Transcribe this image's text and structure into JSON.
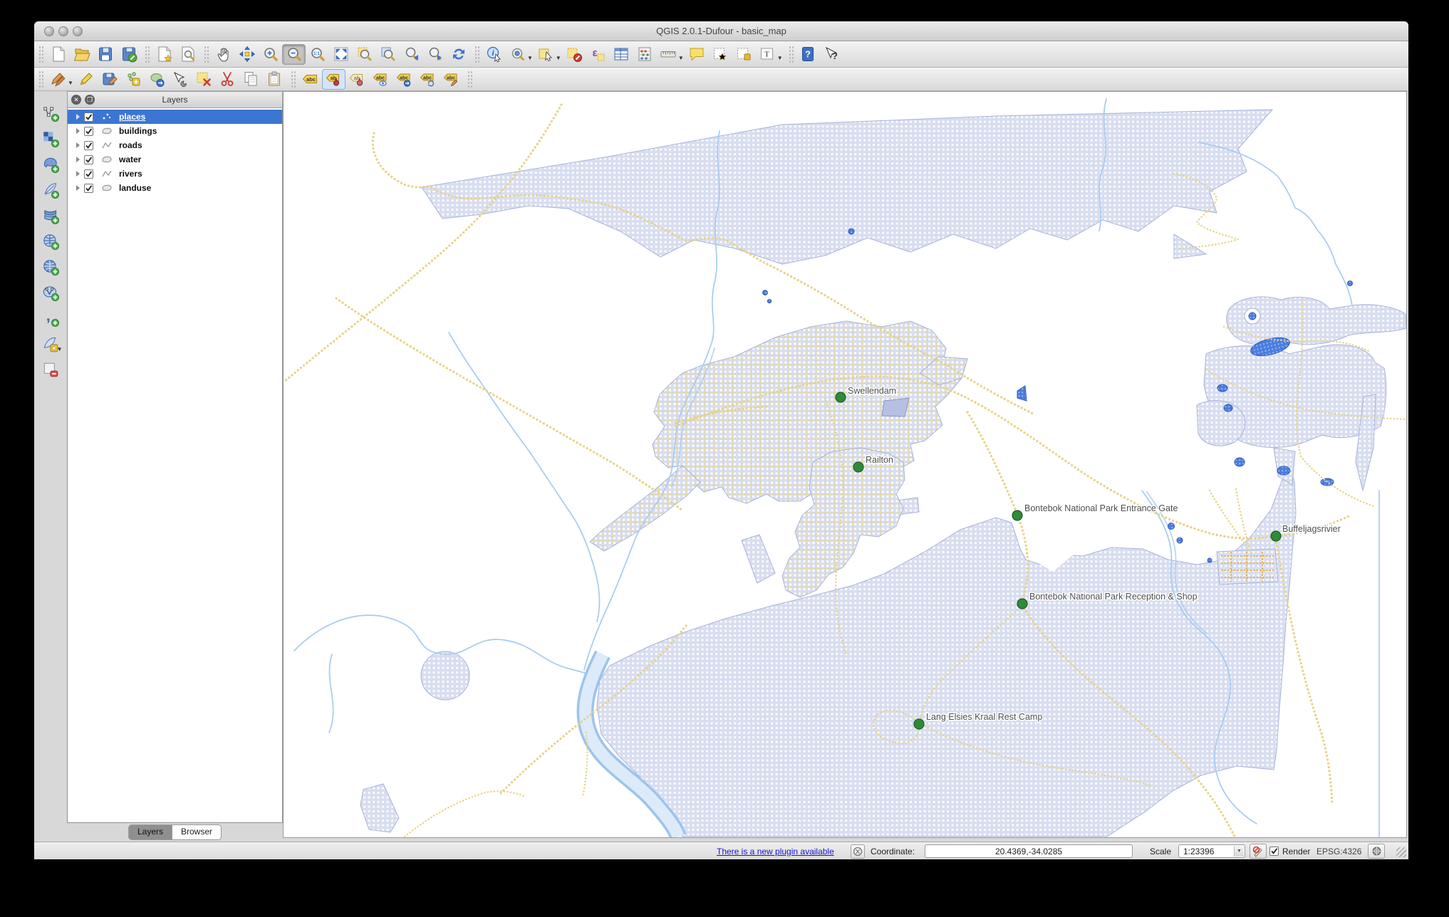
{
  "window": {
    "title": "QGIS 2.0.1-Dufour - basic_map"
  },
  "layers_panel": {
    "title": "Layers",
    "layers": [
      {
        "name": "places",
        "type": "point",
        "checked": true,
        "selected": true
      },
      {
        "name": "buildings",
        "type": "polygon",
        "checked": true,
        "selected": false
      },
      {
        "name": "roads",
        "type": "line",
        "checked": true,
        "selected": false
      },
      {
        "name": "water",
        "type": "polygon",
        "checked": true,
        "selected": false
      },
      {
        "name": "rivers",
        "type": "line",
        "checked": true,
        "selected": false
      },
      {
        "name": "landuse",
        "type": "polygon",
        "checked": true,
        "selected": false
      }
    ],
    "tabs": [
      {
        "label": "Layers",
        "active": true
      },
      {
        "label": "Browser",
        "active": false
      }
    ]
  },
  "toolbars": {
    "active_tool": "zoom-out",
    "file": [
      "new-project",
      "open-project",
      "save-project",
      "save-project-as",
      "new-print-composer",
      "composer-manager"
    ],
    "navigation": [
      "pan-map",
      "pan-to-selection",
      "zoom-in",
      "zoom-out",
      "zoom-actual-size",
      "zoom-full",
      "zoom-to-selection",
      "zoom-to-layer",
      "zoom-last",
      "zoom-next",
      "refresh"
    ],
    "attributes": [
      "identify-features",
      "run-feature-action",
      "select-features",
      "deselect-features",
      "select-by-expression",
      "open-attribute-table",
      "field-calculator",
      "measure-line",
      "map-tips",
      "new-bookmark",
      "show-bookmarks",
      "text-annotation",
      "help-contents",
      "whats-this"
    ],
    "digitizing": [
      "current-edits",
      "toggle-editing",
      "save-layer-edits",
      "add-feature",
      "move-feature",
      "node-tool",
      "delete-selected",
      "cut-features",
      "copy-features",
      "paste-features"
    ],
    "labeling": [
      "label-settings",
      "pin-unpin-labels",
      "highlight-pinned-labels",
      "show-hide-labels",
      "move-label",
      "rotate-label",
      "change-label-properties"
    ],
    "manage_layers": [
      "add-vector-layer",
      "add-raster-layer",
      "add-postgis-layer",
      "add-spatialite-layer",
      "add-mssql-layer",
      "add-wms-layer",
      "add-wcs-layer",
      "add-wfs-layer",
      "add-delimited-text-layer",
      "new-shapefile-layer",
      "remove-layer-group"
    ]
  },
  "status_bar": {
    "plugin_link": "There is a new plugin available",
    "coordinate_label": "Coordinate:",
    "coordinate_value": "20.4369,-34.0285",
    "scale_label": "Scale",
    "scale_value": "1:23396",
    "render_label": "Render",
    "crs": "EPSG:4326"
  },
  "map": {
    "places": [
      {
        "name": "Swellendam"
      },
      {
        "name": "Railton"
      },
      {
        "name": "Bontebok National Park Entrance Gate"
      },
      {
        "name": "Buffeljagsrivier"
      },
      {
        "name": "Bontebok National Park Reception & Shop"
      },
      {
        "name": "Lang Elsies Kraal Rest Camp"
      }
    ],
    "colors": {
      "landuse": "#d8ddf0",
      "urban_road": "#e8d88e",
      "water": "#4a7ce0",
      "river": "#a6cbf0",
      "road": "#e6d387",
      "marker": "#2e8b37",
      "label": "#4f4f4f"
    }
  }
}
